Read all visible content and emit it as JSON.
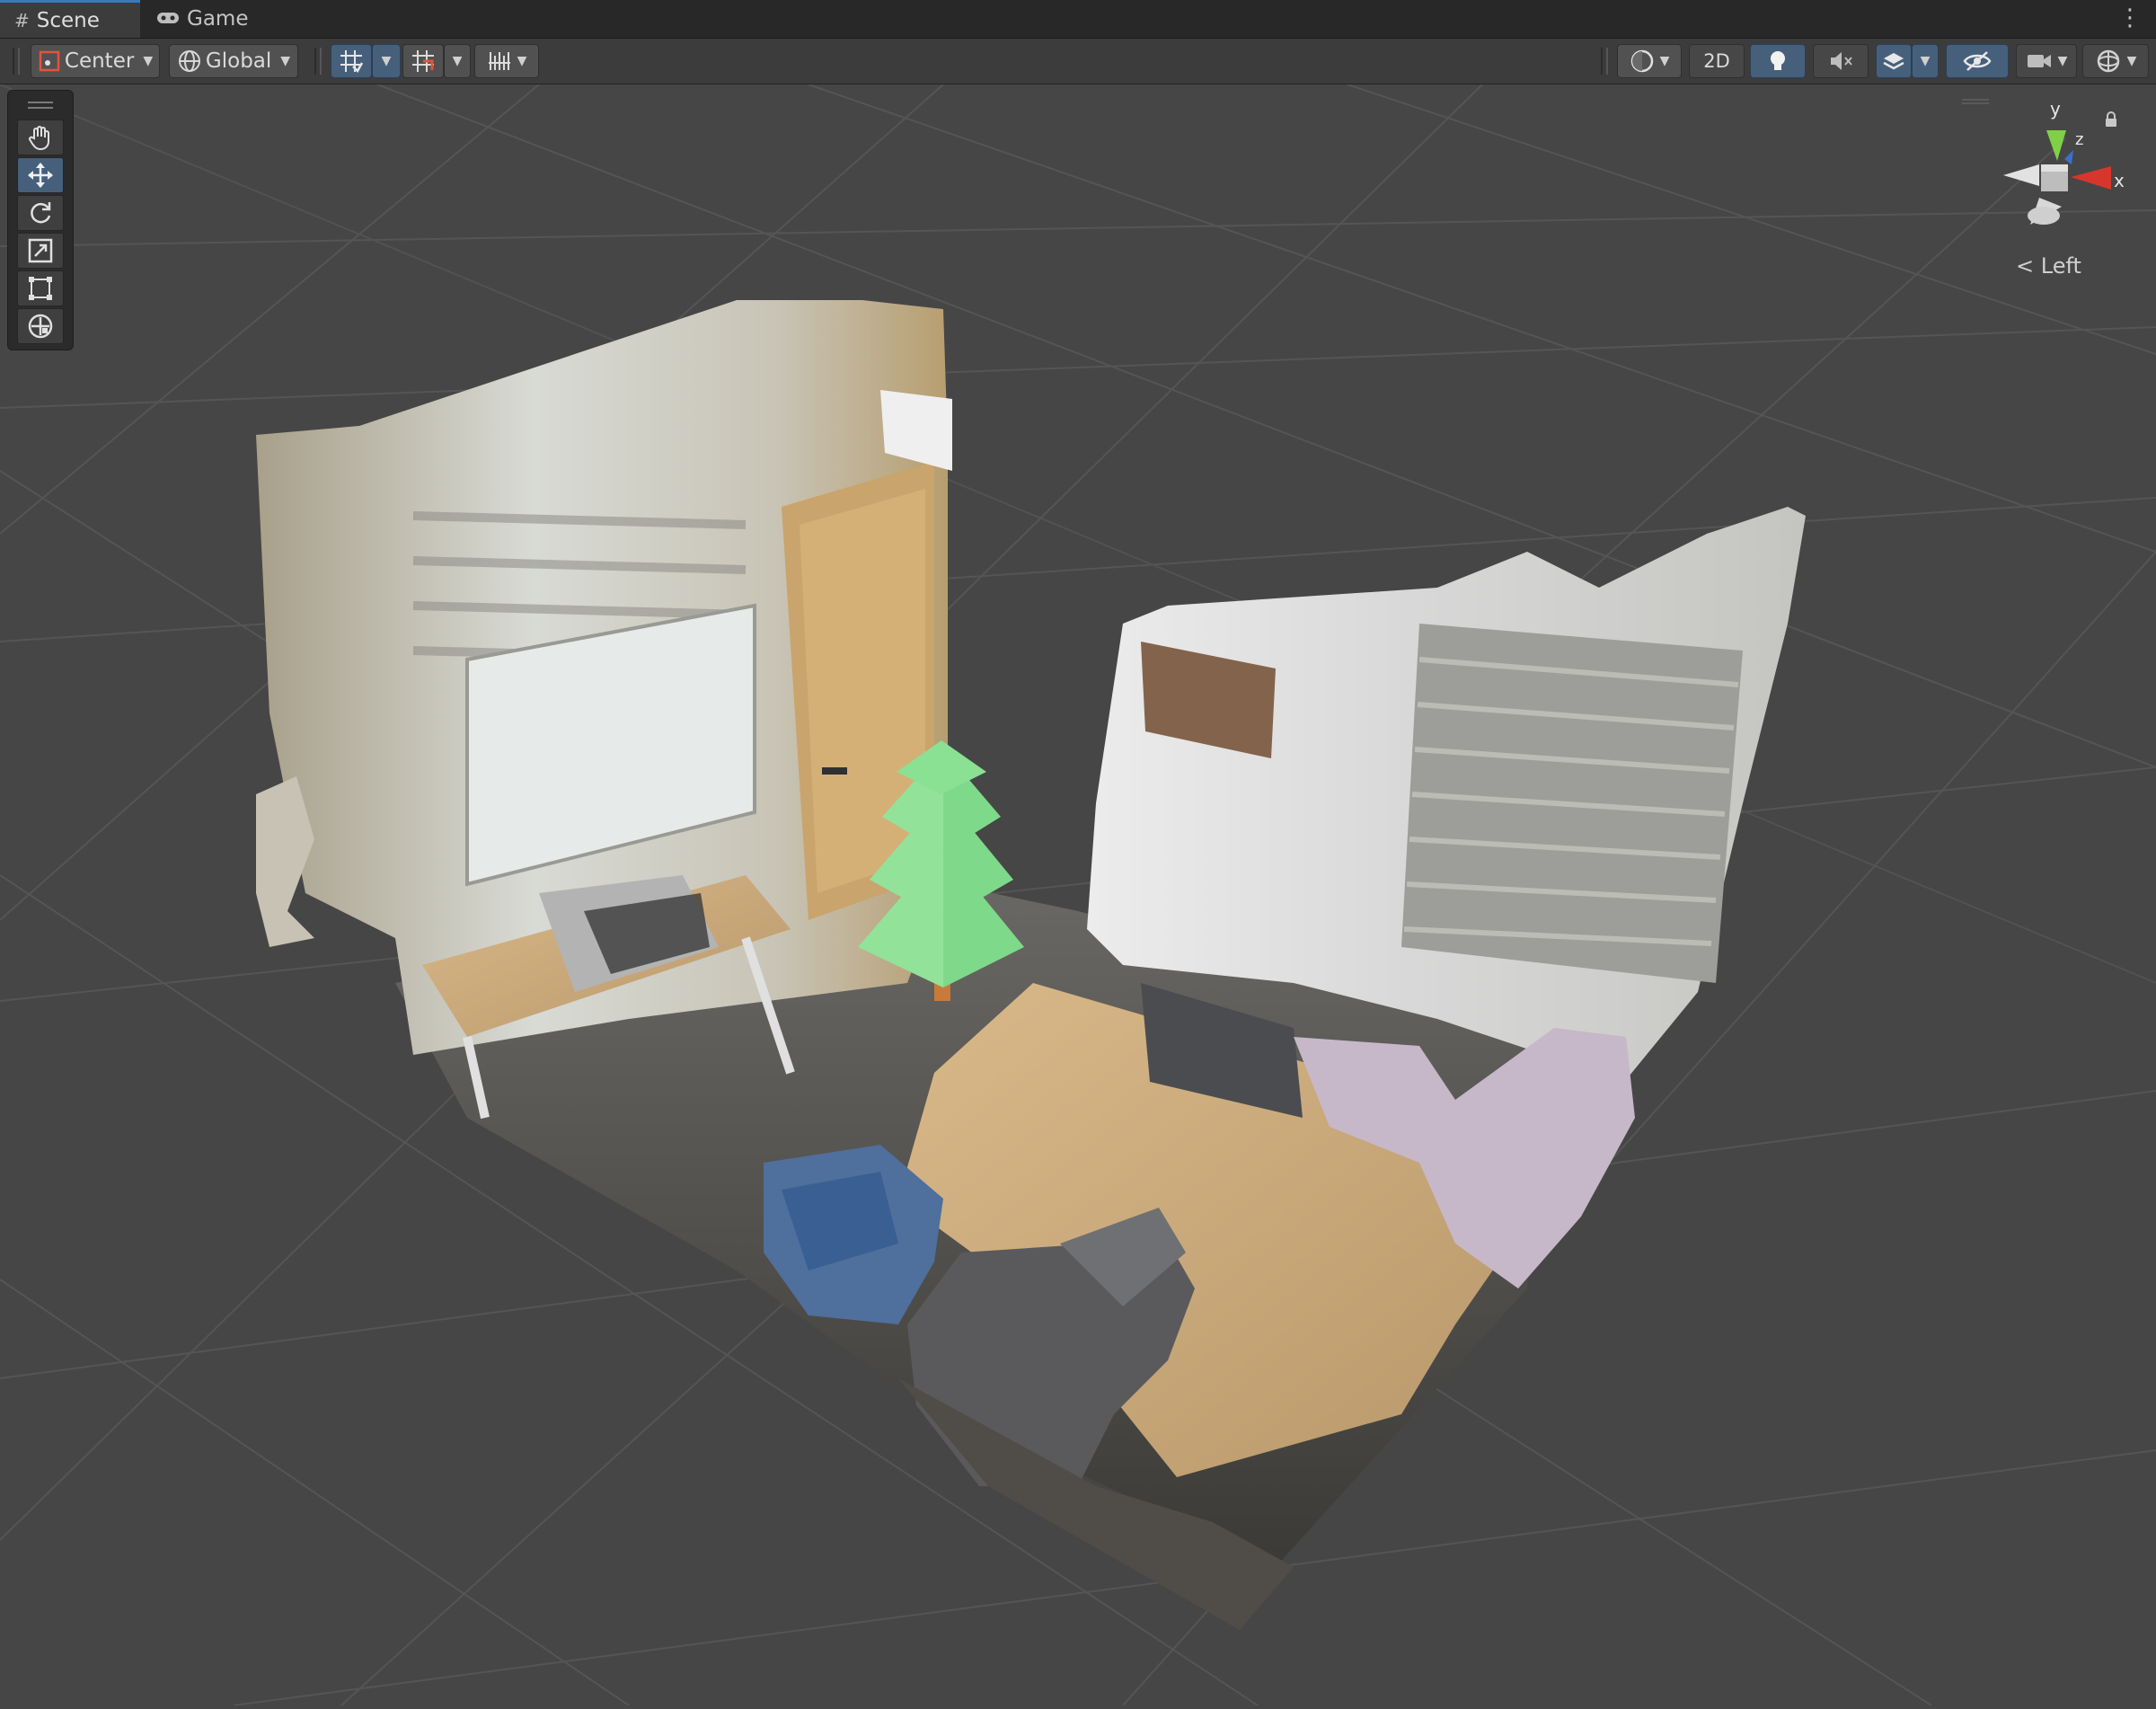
{
  "tabs": [
    {
      "label": "Scene",
      "icon": "grid-hash-icon",
      "active": true
    },
    {
      "label": "Game",
      "icon": "gamepad-icon",
      "active": false
    }
  ],
  "toolbar": {
    "pivot_label": "Center",
    "space_label": "Global",
    "mode_2d_label": "2D"
  },
  "tools": [
    {
      "name": "hand-tool",
      "icon": "hand-icon"
    },
    {
      "name": "move-tool",
      "icon": "move-arrows-icon",
      "active": true
    },
    {
      "name": "rotate-tool",
      "icon": "rotate-icon"
    },
    {
      "name": "scale-tool",
      "icon": "scale-icon"
    },
    {
      "name": "rect-tool",
      "icon": "rect-transform-icon"
    },
    {
      "name": "transform-tool",
      "icon": "transform-icon"
    }
  ],
  "gizmo": {
    "view_label": "Left",
    "axes": {
      "x": "x",
      "y": "y",
      "z": "z"
    }
  },
  "colors": {
    "accent_blue": "#46607c",
    "axis_x": "#d6362b",
    "axis_y": "#7fd046",
    "axis_z": "#3b6fd0",
    "tree_green": "#7fd98a"
  }
}
